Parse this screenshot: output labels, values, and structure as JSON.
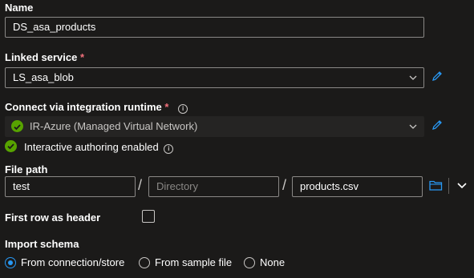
{
  "name": {
    "label": "Name",
    "value": "DS_asa_products"
  },
  "linked_service": {
    "label": "Linked service",
    "required": "*",
    "value": "LS_asa_blob"
  },
  "runtime": {
    "label": "Connect via integration runtime",
    "required": "*",
    "value": "IR-Azure (Managed Virtual Network)"
  },
  "authoring": {
    "text": "Interactive authoring enabled"
  },
  "file_path": {
    "label": "File path",
    "container": "test",
    "directory_placeholder": "Directory",
    "file": "products.csv",
    "separator": "/"
  },
  "first_row": {
    "label": "First row as header",
    "checked": false
  },
  "import_schema": {
    "label": "Import schema",
    "options": [
      "From connection/store",
      "From sample file",
      "None"
    ],
    "selected": "From connection/store"
  },
  "colors": {
    "accent": "#2899f5",
    "success": "#57a300",
    "required": "#f1707b"
  }
}
